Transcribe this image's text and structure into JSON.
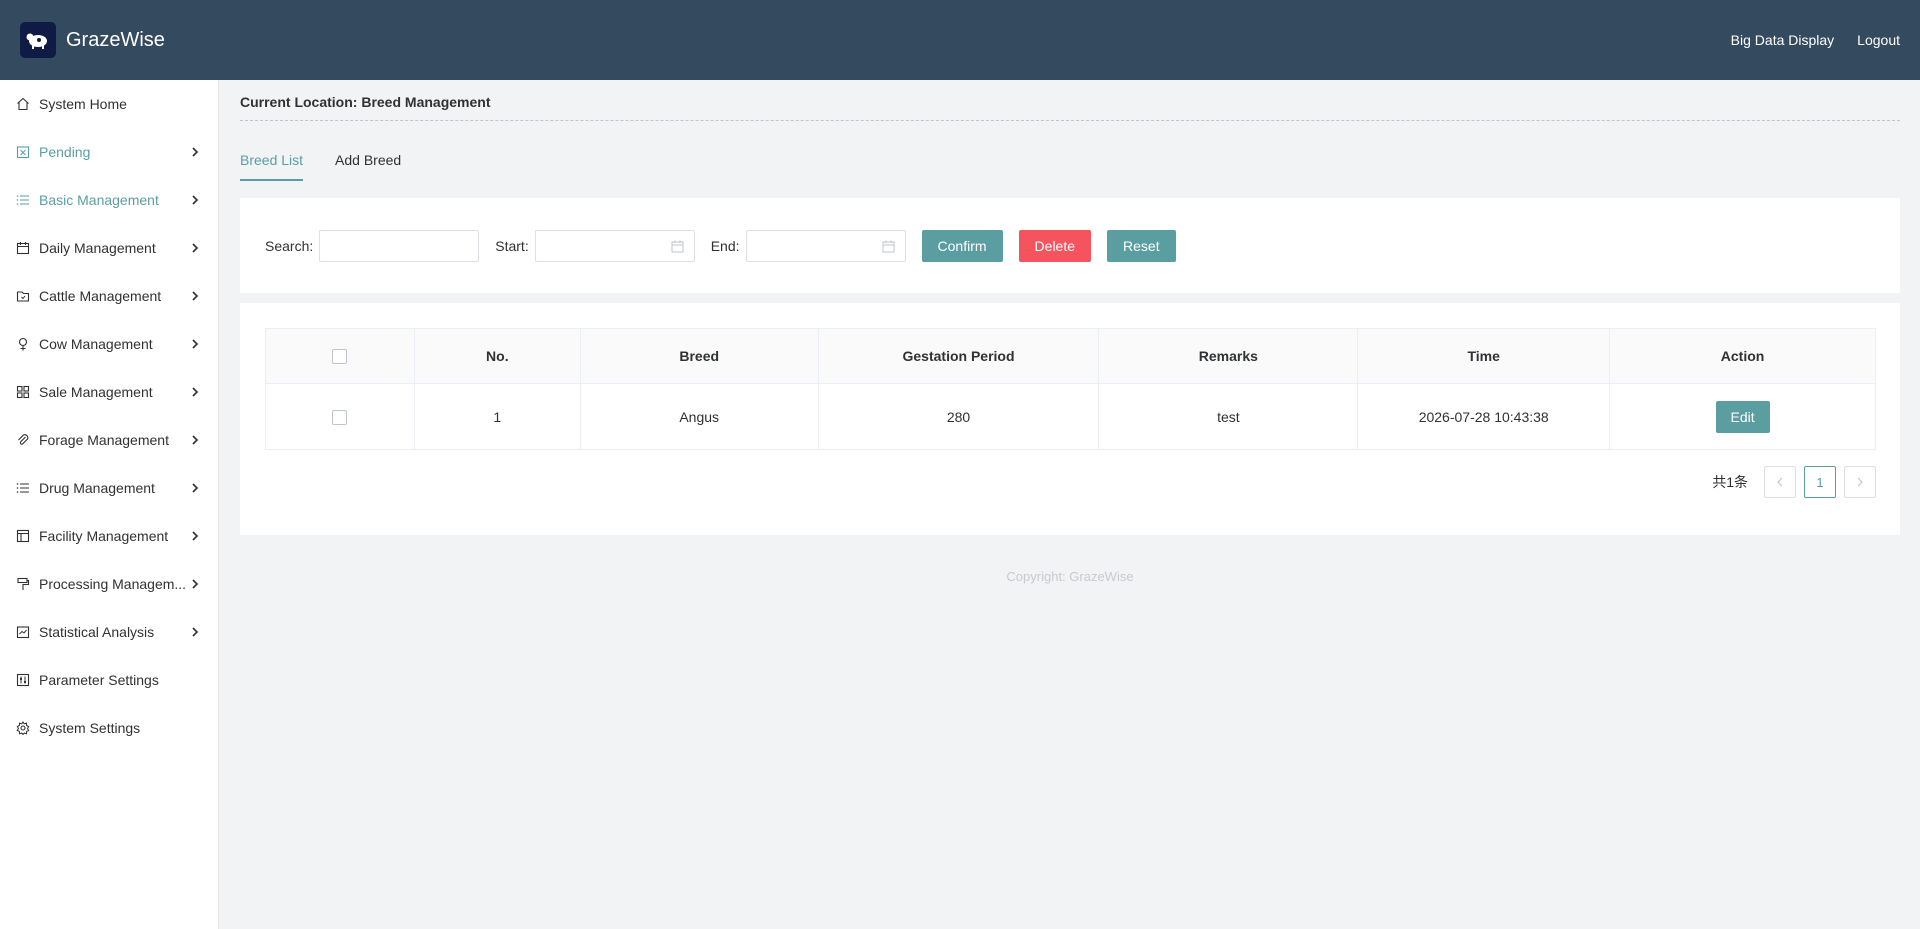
{
  "header": {
    "brand": "GrazeWise",
    "links": [
      "Big Data Display",
      "Logout"
    ]
  },
  "sidebar": {
    "items": [
      {
        "label": "System Home",
        "icon": "home-icon"
      },
      {
        "label": "Pending",
        "icon": "pending-icon"
      },
      {
        "label": "Basic Management",
        "icon": "list-icon"
      },
      {
        "label": "Daily Management",
        "icon": "calendar-icon"
      },
      {
        "label": "Cattle Management",
        "icon": "folder-icon"
      },
      {
        "label": "Cow Management",
        "icon": "female-icon"
      },
      {
        "label": "Sale Management",
        "icon": "grid-icon"
      },
      {
        "label": "Forage Management",
        "icon": "paperclip-icon"
      },
      {
        "label": "Drug Management",
        "icon": "list-icon"
      },
      {
        "label": "Facility Management",
        "icon": "layout-icon"
      },
      {
        "label": "Processing Managem...",
        "icon": "brush-icon"
      },
      {
        "label": "Statistical Analysis",
        "icon": "chart-icon"
      },
      {
        "label": "Parameter Settings",
        "icon": "sliders-icon"
      },
      {
        "label": "System Settings",
        "icon": "gear-icon"
      }
    ]
  },
  "main": {
    "location": "Current Location: Breed Management",
    "tabs": [
      "Breed List",
      "Add Breed"
    ],
    "search": {
      "search_label": "Search:",
      "start_label": "Start:",
      "end_label": "End:",
      "confirm": "Confirm",
      "delete": "Delete",
      "reset": "Reset"
    },
    "table": {
      "headers": [
        "No.",
        "Breed",
        "Gestation Period",
        "Remarks",
        "Time",
        "Action"
      ],
      "rows": [
        {
          "no": "1",
          "breed": "Angus",
          "gestation": "280",
          "remarks": "test",
          "time": "2026-07-28 10:43:38",
          "action": "Edit"
        }
      ]
    },
    "pager": {
      "total": "共1条",
      "current": "1"
    },
    "copyright": "Copyright: GrazeWise"
  },
  "colors": {
    "header_bg": "#344a5f",
    "accent": "#5a9ea2",
    "danger": "#f5545e"
  }
}
